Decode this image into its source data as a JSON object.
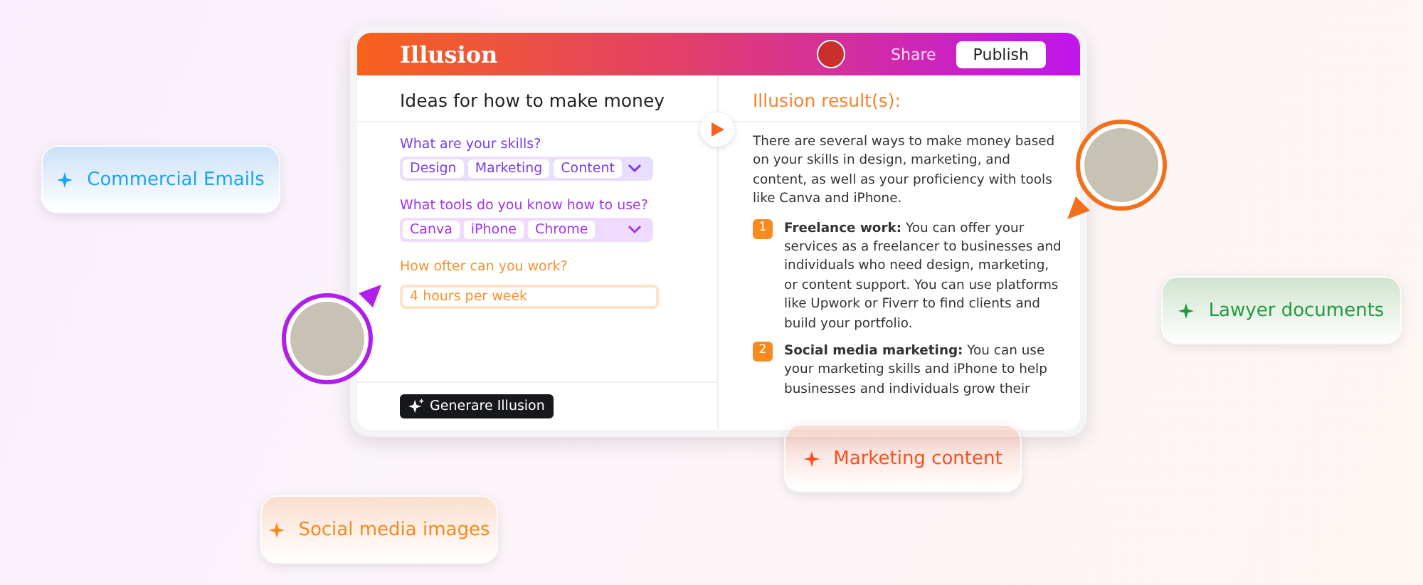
{
  "app": {
    "logo": "Illusion",
    "share": "Share",
    "publish": "Publish"
  },
  "form": {
    "title": "Ideas for how to make money",
    "fields": [
      {
        "kind": "tags",
        "label": "What are your skills?",
        "color": "#7a3cf0",
        "tags": [
          "Design",
          "Marketing",
          "Content"
        ]
      },
      {
        "kind": "tags",
        "label": "What tools do you know how to use?",
        "color": "#a233f0",
        "tags": [
          "Canva",
          "iPhone",
          "Chrome"
        ]
      },
      {
        "kind": "text",
        "label": "How ofter can you work?",
        "color": "#f7922e",
        "value": "4 hours per week"
      }
    ],
    "generate_button": "Generare Illusion"
  },
  "result": {
    "title": "Illusion result(s):",
    "intro": "There are several ways to make money based on your skills in design, marketing, and content, as well as your proficiency with tools like Canva and iPhone.",
    "items": [
      {
        "number": "1",
        "text": "**Freelance work:** You can offer your services as a freelancer to businesses and individuals who need design, marketing, or content support. You can use platforms like Upwork or Fiverr to find clients and build your portfolio."
      },
      {
        "number": "2",
        "text": "**Social media marketing:** You can use your marketing skills and iPhone to help businesses and individuals grow their"
      }
    ]
  },
  "avatars": [
    {
      "color": "#b01fe8"
    },
    {
      "color": "#f2701c"
    }
  ],
  "chips": [
    {
      "label": "Commercial Emails",
      "color": "#1aa6f0"
    },
    {
      "label": "Lawyer documents",
      "color": "#1f9a3c"
    },
    {
      "label": "Marketing content",
      "color": "#f5501e"
    },
    {
      "label": "Social media images",
      "color": "#f5891e"
    }
  ]
}
